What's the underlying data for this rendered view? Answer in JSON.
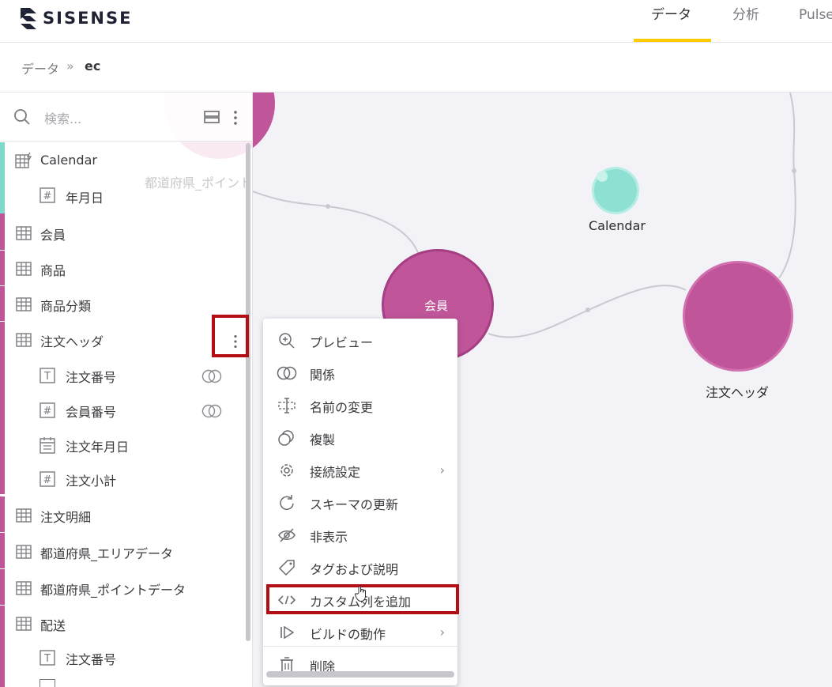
{
  "app": {
    "logo_text": "SISENSE"
  },
  "nav": {
    "tabs": [
      {
        "label": "データ",
        "active": true
      },
      {
        "label": "分析",
        "active": false
      },
      {
        "label": "Pulse",
        "active": false
      }
    ],
    "accent_color": "#ffcb05"
  },
  "breadcrumb": {
    "root": "データ",
    "separator": "»",
    "current": "ec"
  },
  "sidebar": {
    "search_placeholder": "検索...",
    "ghost_label": "都道府県_ポイントデータ",
    "items": [
      {
        "label": "Calendar",
        "kind": "table-date",
        "level": 0,
        "accent": "#7fd9c9"
      },
      {
        "label": "年月日",
        "kind": "number",
        "level": 1,
        "accent": "#7fd9c9"
      },
      {
        "label": "会員",
        "kind": "table",
        "level": 0,
        "accent": "#c0559a"
      },
      {
        "label": "商品",
        "kind": "table",
        "level": 0,
        "accent": "#c0559a"
      },
      {
        "label": "商品分類",
        "kind": "table",
        "level": 0,
        "accent": "#c0559a"
      },
      {
        "label": "注文ヘッダ",
        "kind": "table",
        "level": 0,
        "accent": "#c0559a"
      },
      {
        "label": "注文番号",
        "kind": "text",
        "level": 1,
        "accent": "#c0559a",
        "linked": true
      },
      {
        "label": "会員番号",
        "kind": "number",
        "level": 1,
        "accent": "#c0559a",
        "linked": true
      },
      {
        "label": "注文年月日",
        "kind": "date",
        "level": 1,
        "accent": "#c0559a"
      },
      {
        "label": "注文小計",
        "kind": "number",
        "level": 1,
        "accent": "#c0559a"
      },
      {
        "label": "注文明細",
        "kind": "table",
        "level": 0,
        "accent": "#c0559a"
      },
      {
        "label": "都道府県_エリアデータ",
        "kind": "table",
        "level": 0,
        "accent": "#c0559a"
      },
      {
        "label": "都道府県_ポイントデータ",
        "kind": "table",
        "level": 0,
        "accent": "#c0559a"
      },
      {
        "label": "配送",
        "kind": "table",
        "level": 0,
        "accent": "#c0559a"
      },
      {
        "label": "注文番号",
        "kind": "text",
        "level": 1,
        "accent": "#c0559a"
      }
    ]
  },
  "canvas": {
    "nodes": [
      {
        "label": "会員",
        "color": "#c0559a"
      },
      {
        "label": "注文ヘッダ",
        "color": "#c0559a"
      },
      {
        "label": "Calendar",
        "color": "#8de0d2"
      }
    ]
  },
  "context_menu": {
    "items": [
      {
        "label": "プレビュー",
        "icon": "zoom-in-icon"
      },
      {
        "label": "関係",
        "icon": "relation-icon"
      },
      {
        "label": "名前の変更",
        "icon": "rename-icon"
      },
      {
        "label": "複製",
        "icon": "duplicate-icon"
      },
      {
        "label": "接続設定",
        "icon": "gear-icon",
        "submenu": true
      },
      {
        "label": "スキーマの更新",
        "icon": "refresh-icon"
      },
      {
        "label": "非表示",
        "icon": "eye-off-icon"
      },
      {
        "label": "タグおよび説明",
        "icon": "tag-icon"
      },
      {
        "label": "カスタム列を追加",
        "icon": "code-icon"
      },
      {
        "label": "ビルドの動作",
        "icon": "build-icon",
        "submenu": true
      },
      {
        "label": "削除",
        "icon": "trash-icon"
      }
    ],
    "highlight_color": "#b30e14"
  }
}
